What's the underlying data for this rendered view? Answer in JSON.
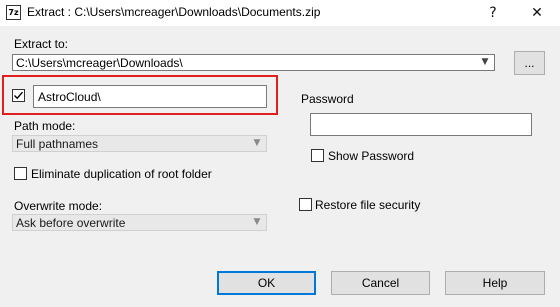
{
  "window": {
    "app_icon": "7z",
    "title": "Extract : C:\\Users\\mcreager\\Downloads\\Documents.zip",
    "help_glyph": "?",
    "close_glyph": "✕"
  },
  "extract_to": {
    "label": "Extract to:",
    "path": "C:\\Users\\mcreager\\Downloads\\",
    "browse_label": "..."
  },
  "subfolder": {
    "checked": true,
    "value": "AstroCloud\\"
  },
  "path_mode": {
    "label": "Path mode:",
    "selected": "Full pathnames"
  },
  "eliminate_duplication": {
    "label": "Eliminate duplication of root folder",
    "checked": false
  },
  "overwrite_mode": {
    "label": "Overwrite mode:",
    "selected": "Ask before overwrite"
  },
  "password": {
    "label": "Password",
    "value": "",
    "show_label": "Show Password",
    "show_checked": false
  },
  "restore_security": {
    "label": "Restore file security",
    "checked": false
  },
  "buttons": {
    "ok": "OK",
    "cancel": "Cancel",
    "help": "Help"
  },
  "colors": {
    "highlight": "#e02020",
    "default_button_border": "#0078d7"
  }
}
